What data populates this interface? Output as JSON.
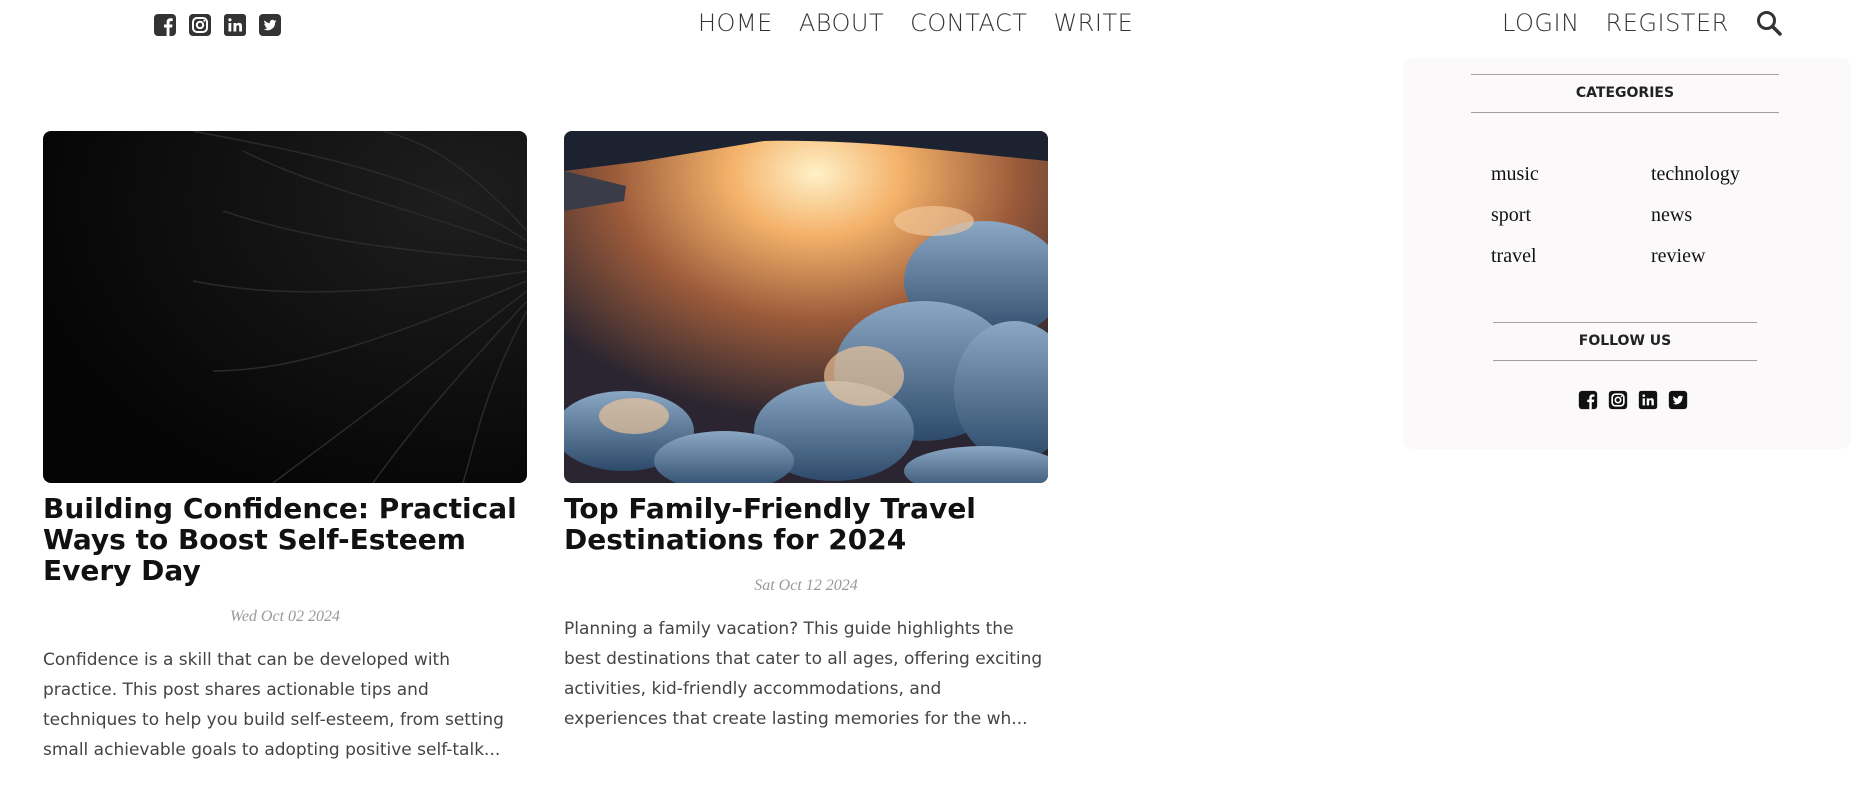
{
  "nav": {
    "social": [
      "facebook-square-icon",
      "instagram-icon",
      "linkedin-icon",
      "twitter-square-icon"
    ],
    "links": [
      "HOME",
      "ABOUT",
      "CONTACT",
      "WRITE"
    ],
    "auth": [
      "LOGIN",
      "REGISTER"
    ],
    "search_icon": "search-icon"
  },
  "posts": [
    {
      "title": "Building Confidence: Practical Ways to Boost Self-Esteem Every Day",
      "date": "Wed Oct 02 2024",
      "excerpt": "Confidence is a skill that can be developed with practice. This post shares actionable tips and techniques to help you build self-esteem, from setting small achievable goals to adopting positive self-talk..."
    },
    {
      "title": "Top Family-Friendly Travel Destinations for 2024",
      "date": "Sat Oct 12 2024",
      "excerpt": "Planning a family vacation? This guide highlights the best destinations that cater to all ages, offering exciting activities, kid-friendly accommodations, and experiences that create lasting memories for the wh..."
    }
  ],
  "sidebar": {
    "categories_title": "CATEGORIES",
    "categories": [
      "music",
      "technology",
      "sport",
      "news",
      "travel",
      "review"
    ],
    "follow_title": "FOLLOW US"
  },
  "colors": {
    "text": "#111111",
    "muted": "#999999",
    "sidebar_bg": "#fbf9f9"
  }
}
